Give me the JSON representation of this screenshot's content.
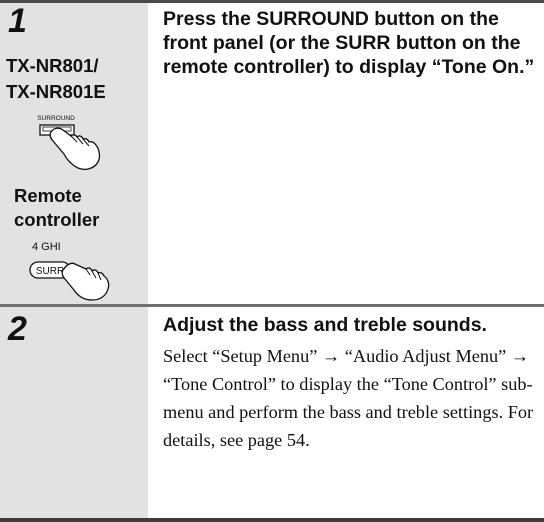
{
  "step1": {
    "number": "1",
    "models": [
      "TX-NR801/",
      "TX-NR801E"
    ],
    "panel_button_label": "SURROUND",
    "remote_caption": [
      "Remote",
      "controller"
    ],
    "remote_key_label": "4  GHI",
    "remote_button_label": "SURR",
    "heading": "Press the SURROUND button on the front panel (or the SURR button on the remote controller) to display “Tone On.”"
  },
  "step2": {
    "number": "2",
    "heading": "Adjust the bass and treble sounds.",
    "body": "Select “Setup Menu” → “Audio Adjust Menu” → “Tone Control” to display the “Tone Control” sub-menu and perform the bass and treble settings. For details, see page 54."
  }
}
